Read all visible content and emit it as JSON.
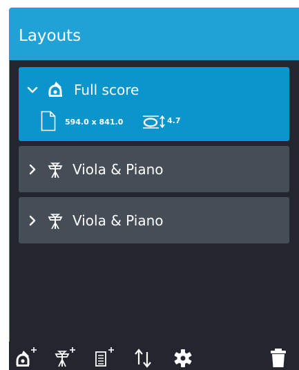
{
  "panel": {
    "title": "Layouts"
  },
  "layouts": [
    {
      "label": "Full score",
      "expanded": true,
      "selected": true,
      "icon": "full-score-icon",
      "page_size": "594.0 x 841.0",
      "staff_size": "4.7"
    },
    {
      "label": "Viola & Piano",
      "expanded": false,
      "selected": false,
      "icon": "part-layout-icon"
    },
    {
      "label": "Viola & Piano",
      "expanded": false,
      "selected": false,
      "icon": "part-layout-icon"
    }
  ],
  "toolbar": {
    "buttons": [
      "new-full-score-layout-icon",
      "new-part-layout-icon",
      "new-custom-score-layout-icon",
      "sort-icon",
      "settings-gear-icon",
      "delete-trash-icon"
    ]
  },
  "colors": {
    "panel_blue": "#21a2d6",
    "selected_item": "#0a95cd",
    "item": "#454d57",
    "list_background": "#23262e",
    "text": "#ffffff"
  }
}
